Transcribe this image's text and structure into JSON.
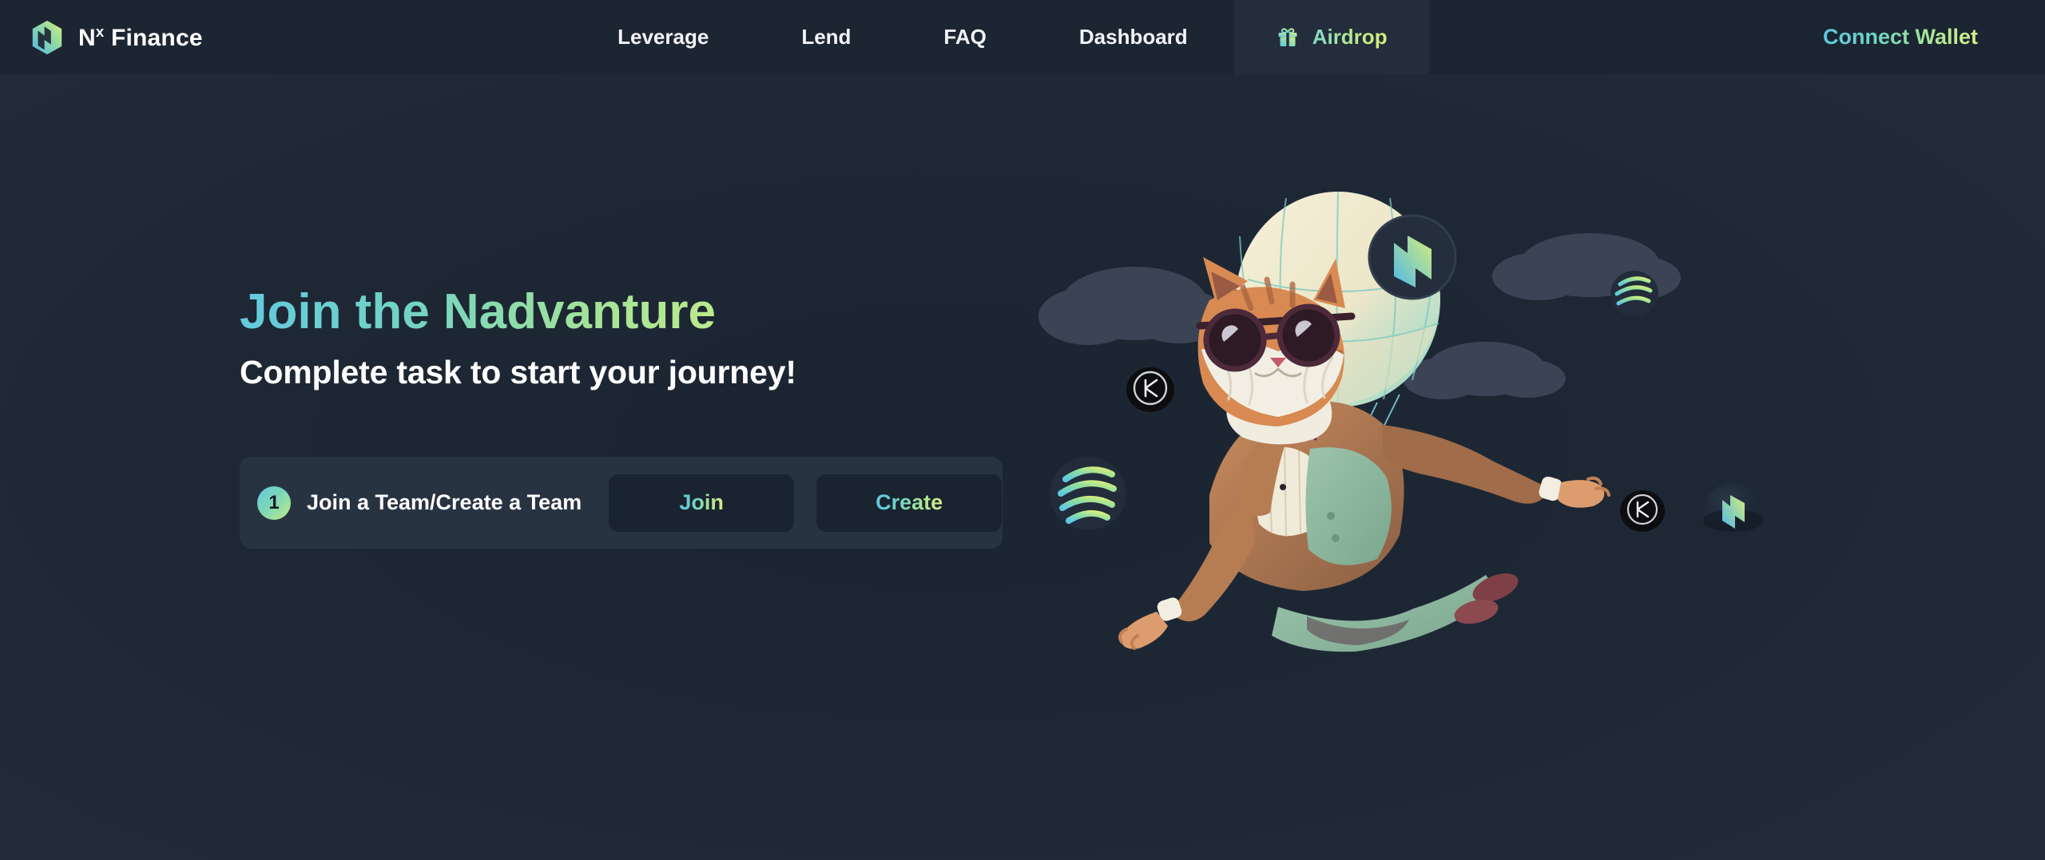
{
  "brand": {
    "name_prefix": "N",
    "name_sup": "x",
    "name_suffix": " Finance",
    "logo_icon": "nx-finance-logo-icon",
    "logo_gradient_from": "#4fb8e8",
    "logo_gradient_to": "#d4ee7a"
  },
  "nav": {
    "items": [
      {
        "label": "Leverage",
        "active": false
      },
      {
        "label": "Lend",
        "active": false
      },
      {
        "label": "FAQ",
        "active": false
      },
      {
        "label": "Dashboard",
        "active": false
      },
      {
        "label": "Airdrop",
        "active": true,
        "icon": "gift-icon"
      }
    ]
  },
  "wallet": {
    "connect_label": "Connect Wallet"
  },
  "hero": {
    "title": "Join the Nadvanture",
    "subtitle": "Complete task to start your journey!",
    "title_gradient_from": "#63c9dd",
    "title_gradient_to": "#cdee86"
  },
  "task": {
    "step_number": "1",
    "label": "Join a Team/Create a Team",
    "join_label": "Join",
    "create_label": "Create"
  },
  "illustration": {
    "description": "cat-in-suit-hanging-from-hot-air-balloon",
    "balloon_badge_icon": "nx-finance-coin-icon",
    "tokens": [
      {
        "name": "monad-token-icon",
        "glyph": "K"
      },
      {
        "name": "striped-token-icon"
      },
      {
        "name": "nx-finance-token-icon"
      }
    ]
  },
  "theme": {
    "background": "#1e2835",
    "navbar_background": "#1c2532",
    "active_tab_background": "#232d3c",
    "card_background": "#283342",
    "button_background": "#1a2330",
    "accent_cyan": "#63c9dd",
    "accent_green": "#cdee86",
    "cloud_color": "#3d4657"
  }
}
